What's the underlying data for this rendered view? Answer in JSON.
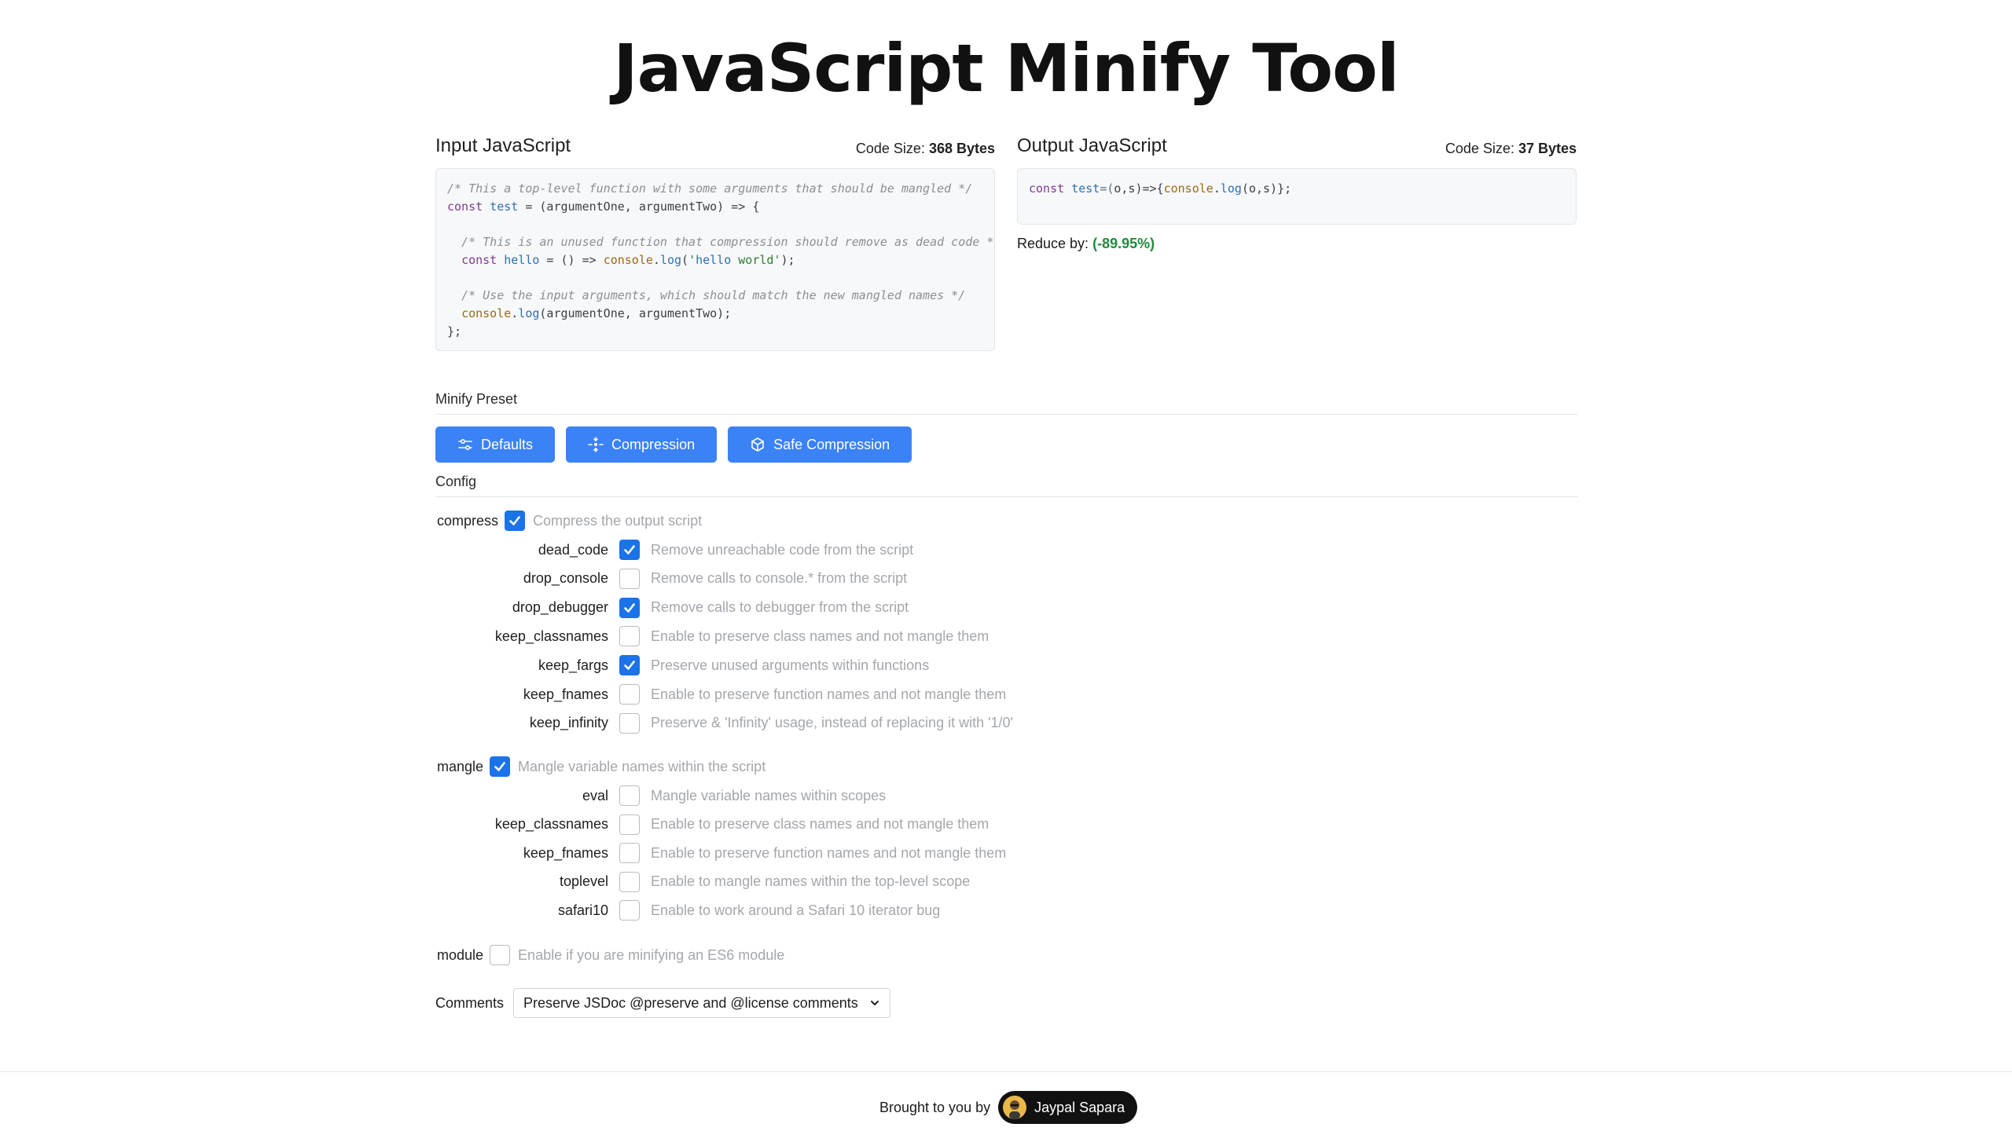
{
  "page": {
    "title": "JavaScript Minify Tool"
  },
  "input": {
    "title": "Input JavaScript",
    "size_label": "Code Size:",
    "size_value": "368 Bytes",
    "lines": [
      "/* This a top-level function with some arguments that should be mangled */",
      "const test = (argumentOne, argumentTwo) => {",
      "",
      "  /* This is an unused function that compression should remove as dead code */",
      "  const hello = () => console.log('hello world');",
      "",
      "  /* Use the input arguments, which should match the new mangled names */",
      "  console.log(argumentOne, argumentTwo);",
      "};"
    ]
  },
  "output": {
    "title": "Output JavaScript",
    "size_label": "Code Size:",
    "size_value": "37 Bytes",
    "code": "const test=(o,s)=>{console.log(o,s)};",
    "reduce_label": "Reduce by:",
    "reduce_value": "(-89.95%)"
  },
  "preset": {
    "label": "Minify Preset",
    "buttons": [
      {
        "label": "Defaults",
        "icon": "sliders-icon"
      },
      {
        "label": "Compression",
        "icon": "compress-icon"
      },
      {
        "label": "Safe Compression",
        "icon": "box-icon"
      }
    ]
  },
  "config": {
    "label": "Config",
    "compress": {
      "name": "compress",
      "checked": true,
      "desc": "Compress the output script",
      "options": [
        {
          "name": "dead_code",
          "checked": true,
          "desc": "Remove unreachable code from the script"
        },
        {
          "name": "drop_console",
          "checked": false,
          "desc": "Remove calls to console.* from the script"
        },
        {
          "name": "drop_debugger",
          "checked": true,
          "desc": "Remove calls to debugger from the script"
        },
        {
          "name": "keep_classnames",
          "checked": false,
          "desc": "Enable to preserve class names and not mangle them"
        },
        {
          "name": "keep_fargs",
          "checked": true,
          "desc": "Preserve unused arguments within functions"
        },
        {
          "name": "keep_fnames",
          "checked": false,
          "desc": "Enable to preserve function names and not mangle them"
        },
        {
          "name": "keep_infinity",
          "checked": false,
          "desc": "Preserve & 'Infinity' usage, instead of replacing it with '1/0'"
        }
      ]
    },
    "mangle": {
      "name": "mangle",
      "checked": true,
      "desc": "Mangle variable names within the script",
      "options": [
        {
          "name": "eval",
          "checked": false,
          "desc": "Mangle variable names within scopes"
        },
        {
          "name": "keep_classnames",
          "checked": false,
          "desc": "Enable to preserve class names and not mangle them"
        },
        {
          "name": "keep_fnames",
          "checked": false,
          "desc": "Enable to preserve function names and not mangle them"
        },
        {
          "name": "toplevel",
          "checked": false,
          "desc": "Enable to mangle names within the top-level scope"
        },
        {
          "name": "safari10",
          "checked": false,
          "desc": "Enable to work around a Safari 10 iterator bug"
        }
      ]
    },
    "module": {
      "name": "module",
      "checked": false,
      "desc": "Enable if you are minifying an ES6 module"
    },
    "comments": {
      "label": "Comments",
      "selected": "Preserve JSDoc @preserve and @license comments"
    }
  },
  "footer": {
    "text": "Brought to you by",
    "author": "Jaypal Sapara"
  },
  "colors": {
    "accent": "#3b82f6",
    "checkbox": "#1a73e8",
    "reduce": "#1e8c3c"
  }
}
